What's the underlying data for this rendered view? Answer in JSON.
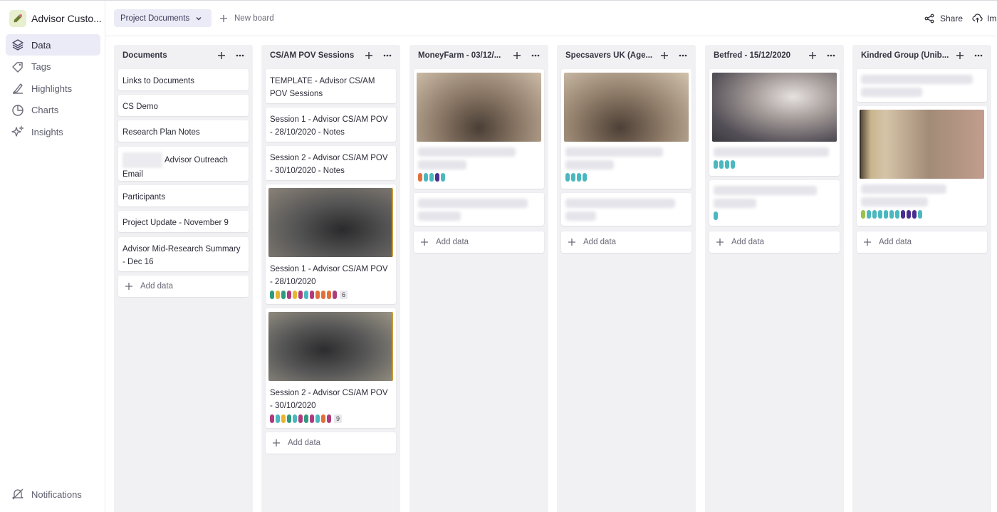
{
  "workspace": {
    "name": "Advisor Custo..."
  },
  "nav": {
    "items": [
      {
        "label": "Data",
        "icon": "layers-icon"
      },
      {
        "label": "Tags",
        "icon": "tag-icon"
      },
      {
        "label": "Highlights",
        "icon": "highlighter-icon"
      },
      {
        "label": "Charts",
        "icon": "pie-chart-icon"
      },
      {
        "label": "Insights",
        "icon": "sparkle-icon"
      }
    ],
    "notifications": "Notifications"
  },
  "topbar": {
    "board_select": "Project Documents",
    "new_board": "New board",
    "share": "Share",
    "import": "Im"
  },
  "add_label": "Add data",
  "columns": [
    {
      "title": "Documents",
      "cards": [
        "Links to Documents",
        "CS Demo",
        "Research Plan Notes",
        "Advisor Outreach Email",
        "Participants",
        "Project Update - November 9",
        "Advisor Mid-Research Summary - Dec 16"
      ]
    },
    {
      "title": "CS/AM POV Sessions",
      "cards": [
        "TEMPLATE - Advisor CS/AM POV Sessions",
        "Session 1 - Advisor CS/AM POV - 28/10/2020 - Notes",
        "Session 2 - Advisor CS/AM POV - 30/10/2020 - Notes",
        "Session 1 - Advisor CS/AM POV - 28/10/2020",
        "Session 2 - Advisor CS/AM POV - 30/10/2020"
      ],
      "tag_counts": [
        "6",
        "9"
      ]
    },
    {
      "title": "MoneyFarm - 03/12/..."
    },
    {
      "title": "Specsavers UK (Age..."
    },
    {
      "title": "Betfred - 15/12/2020"
    },
    {
      "title": "Kindred Group (Unib..."
    }
  ],
  "colors": {
    "active_nav": "#ebebf7",
    "column_bg": "#f1f1f4",
    "tag_teal": "#4bb8bf",
    "tag_magenta": "#b03a7e",
    "tag_orange": "#e2703a",
    "tag_yellow": "#e7b52f",
    "tag_purple": "#4a2f8f",
    "tag_green": "#2f9a7e",
    "tag_lime": "#9cc04a"
  }
}
